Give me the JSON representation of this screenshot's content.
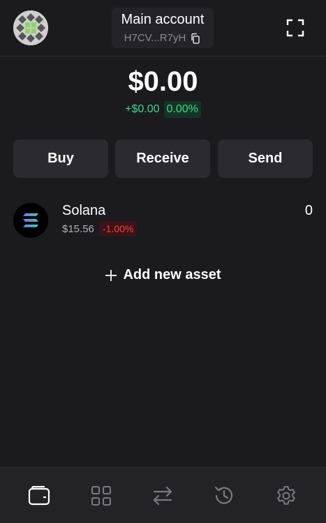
{
  "header": {
    "account_name": "Main account",
    "account_address": "H7CV...R7yH",
    "icons": [
      "avatar",
      "copy-icon",
      "expand-icon"
    ]
  },
  "balance": {
    "total": "$0.00",
    "change_usd": "+$0.00",
    "change_pct": "0.00%"
  },
  "actions": {
    "buy": "Buy",
    "receive": "Receive",
    "send": "Send"
  },
  "assets": [
    {
      "name": "Solana",
      "price": "$15.56",
      "change": "-1.00%",
      "balance": "0",
      "icon": "solana-icon"
    }
  ],
  "add_asset_label": "Add new asset",
  "tabbar": {
    "items": [
      "wallet-icon",
      "apps-grid-icon",
      "swap-icon",
      "history-icon",
      "settings-icon"
    ],
    "active": "wallet-icon"
  },
  "colors": {
    "background": "#1a1a1f",
    "positive": "#3dd68c",
    "negative": "#ff3b3b"
  }
}
